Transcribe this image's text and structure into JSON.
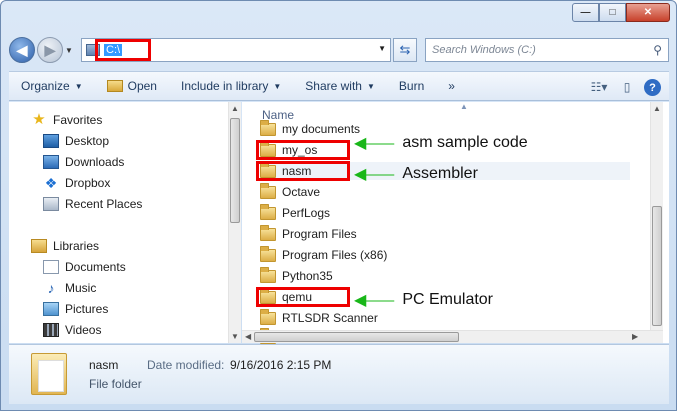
{
  "window": {
    "caption": {
      "minimize": "—",
      "maximize": "□",
      "close": "✕"
    }
  },
  "address": {
    "path": "C:\\",
    "search_placeholder": "Search Windows (C:)"
  },
  "toolbar": {
    "organize": "Organize",
    "open": "Open",
    "include_in_library": "Include in library",
    "share_with": "Share with",
    "burn": "Burn",
    "more": "»"
  },
  "sidebar": {
    "favorites_header": "Favorites",
    "favorites": [
      "Desktop",
      "Downloads",
      "Dropbox",
      "Recent Places"
    ],
    "libraries_header": "Libraries",
    "libraries": [
      "Documents",
      "Music",
      "Pictures",
      "Videos"
    ]
  },
  "content": {
    "column_name": "Name",
    "files": [
      "my documents",
      "my_os",
      "nasm",
      "Octave",
      "PerfLogs",
      "Program Files",
      "Program Files (x86)",
      "Python35",
      "qemu",
      "RTLSDR Scanner"
    ],
    "selected_index": 2
  },
  "annotations": {
    "my_os": "asm sample code",
    "nasm": "Assembler",
    "qemu": "PC Emulator",
    "color": "#e00000",
    "arrow_color": "#19b719"
  },
  "details": {
    "name": "nasm",
    "type": "File folder",
    "modified_label": "Date modified:",
    "modified_value": "9/16/2016 2:15 PM"
  }
}
